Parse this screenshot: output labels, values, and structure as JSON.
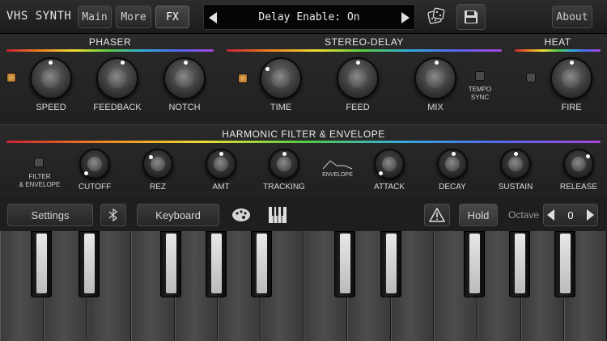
{
  "app": {
    "title": "VHS SYNTH"
  },
  "tabs": [
    {
      "label": "Main"
    },
    {
      "label": "More"
    },
    {
      "label": "FX"
    }
  ],
  "display": {
    "text": "Delay Enable: On"
  },
  "header": {
    "about_label": "About"
  },
  "phaser": {
    "title": "PHASER",
    "enabled": true,
    "knobs": [
      {
        "label": "SPEED"
      },
      {
        "label": "FEEDBACK"
      },
      {
        "label": "NOTCH"
      }
    ]
  },
  "stereo_delay": {
    "title": "STEREO-DELAY",
    "enabled": true,
    "knobs": [
      {
        "label": "TIME"
      },
      {
        "label": "FEED"
      },
      {
        "label": "MIX"
      }
    ],
    "tempo_sync": {
      "label_1": "TEMPO",
      "label_2": "SYNC",
      "enabled": false
    }
  },
  "heat": {
    "title": "HEAT",
    "enabled": false,
    "knobs": [
      {
        "label": "FIRE"
      }
    ]
  },
  "harmonic_filter": {
    "title": "HARMONIC FILTER & ENVELOPE",
    "toggle": {
      "label_1": "FILTER",
      "label_2": "& ENVELOPE",
      "enabled": false
    },
    "envelope_label": "ENVELOPE",
    "knobs": [
      {
        "label": "CUTOFF"
      },
      {
        "label": "REZ"
      },
      {
        "label": "AMT"
      },
      {
        "label": "TRACKING"
      },
      {
        "label": "ATTACK"
      },
      {
        "label": "DECAY"
      },
      {
        "label": "SUSTAIN"
      },
      {
        "label": "RELEASE"
      }
    ]
  },
  "bottom": {
    "settings_label": "Settings",
    "keyboard_label": "Keyboard",
    "hold_label": "Hold",
    "octave_label": "Octave",
    "octave_value": "0"
  },
  "icons": {
    "bluetooth": "bluetooth-icon",
    "palette": "palette-icon",
    "piano": "piano-icon",
    "warning": "warning-icon",
    "dice": "dice-icon",
    "save": "save-icon"
  },
  "colors": {
    "background": "#1c1c1c",
    "led_on": "#d89a45",
    "key_highlight": "#e8e8e8"
  }
}
